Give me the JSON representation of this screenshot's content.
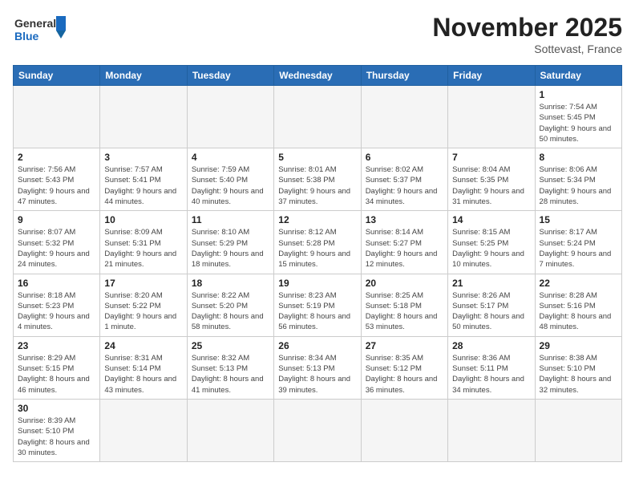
{
  "header": {
    "logo_general": "General",
    "logo_blue": "Blue",
    "month_title": "November 2025",
    "location": "Sottevast, France"
  },
  "days_of_week": [
    "Sunday",
    "Monday",
    "Tuesday",
    "Wednesday",
    "Thursday",
    "Friday",
    "Saturday"
  ],
  "weeks": [
    [
      {
        "day": "",
        "info": ""
      },
      {
        "day": "",
        "info": ""
      },
      {
        "day": "",
        "info": ""
      },
      {
        "day": "",
        "info": ""
      },
      {
        "day": "",
        "info": ""
      },
      {
        "day": "",
        "info": ""
      },
      {
        "day": "1",
        "info": "Sunrise: 7:54 AM\nSunset: 5:45 PM\nDaylight: 9 hours and 50 minutes."
      }
    ],
    [
      {
        "day": "2",
        "info": "Sunrise: 7:56 AM\nSunset: 5:43 PM\nDaylight: 9 hours and 47 minutes."
      },
      {
        "day": "3",
        "info": "Sunrise: 7:57 AM\nSunset: 5:41 PM\nDaylight: 9 hours and 44 minutes."
      },
      {
        "day": "4",
        "info": "Sunrise: 7:59 AM\nSunset: 5:40 PM\nDaylight: 9 hours and 40 minutes."
      },
      {
        "day": "5",
        "info": "Sunrise: 8:01 AM\nSunset: 5:38 PM\nDaylight: 9 hours and 37 minutes."
      },
      {
        "day": "6",
        "info": "Sunrise: 8:02 AM\nSunset: 5:37 PM\nDaylight: 9 hours and 34 minutes."
      },
      {
        "day": "7",
        "info": "Sunrise: 8:04 AM\nSunset: 5:35 PM\nDaylight: 9 hours and 31 minutes."
      },
      {
        "day": "8",
        "info": "Sunrise: 8:06 AM\nSunset: 5:34 PM\nDaylight: 9 hours and 28 minutes."
      }
    ],
    [
      {
        "day": "9",
        "info": "Sunrise: 8:07 AM\nSunset: 5:32 PM\nDaylight: 9 hours and 24 minutes."
      },
      {
        "day": "10",
        "info": "Sunrise: 8:09 AM\nSunset: 5:31 PM\nDaylight: 9 hours and 21 minutes."
      },
      {
        "day": "11",
        "info": "Sunrise: 8:10 AM\nSunset: 5:29 PM\nDaylight: 9 hours and 18 minutes."
      },
      {
        "day": "12",
        "info": "Sunrise: 8:12 AM\nSunset: 5:28 PM\nDaylight: 9 hours and 15 minutes."
      },
      {
        "day": "13",
        "info": "Sunrise: 8:14 AM\nSunset: 5:27 PM\nDaylight: 9 hours and 12 minutes."
      },
      {
        "day": "14",
        "info": "Sunrise: 8:15 AM\nSunset: 5:25 PM\nDaylight: 9 hours and 10 minutes."
      },
      {
        "day": "15",
        "info": "Sunrise: 8:17 AM\nSunset: 5:24 PM\nDaylight: 9 hours and 7 minutes."
      }
    ],
    [
      {
        "day": "16",
        "info": "Sunrise: 8:18 AM\nSunset: 5:23 PM\nDaylight: 9 hours and 4 minutes."
      },
      {
        "day": "17",
        "info": "Sunrise: 8:20 AM\nSunset: 5:22 PM\nDaylight: 9 hours and 1 minute."
      },
      {
        "day": "18",
        "info": "Sunrise: 8:22 AM\nSunset: 5:20 PM\nDaylight: 8 hours and 58 minutes."
      },
      {
        "day": "19",
        "info": "Sunrise: 8:23 AM\nSunset: 5:19 PM\nDaylight: 8 hours and 56 minutes."
      },
      {
        "day": "20",
        "info": "Sunrise: 8:25 AM\nSunset: 5:18 PM\nDaylight: 8 hours and 53 minutes."
      },
      {
        "day": "21",
        "info": "Sunrise: 8:26 AM\nSunset: 5:17 PM\nDaylight: 8 hours and 50 minutes."
      },
      {
        "day": "22",
        "info": "Sunrise: 8:28 AM\nSunset: 5:16 PM\nDaylight: 8 hours and 48 minutes."
      }
    ],
    [
      {
        "day": "23",
        "info": "Sunrise: 8:29 AM\nSunset: 5:15 PM\nDaylight: 8 hours and 46 minutes."
      },
      {
        "day": "24",
        "info": "Sunrise: 8:31 AM\nSunset: 5:14 PM\nDaylight: 8 hours and 43 minutes."
      },
      {
        "day": "25",
        "info": "Sunrise: 8:32 AM\nSunset: 5:13 PM\nDaylight: 8 hours and 41 minutes."
      },
      {
        "day": "26",
        "info": "Sunrise: 8:34 AM\nSunset: 5:13 PM\nDaylight: 8 hours and 39 minutes."
      },
      {
        "day": "27",
        "info": "Sunrise: 8:35 AM\nSunset: 5:12 PM\nDaylight: 8 hours and 36 minutes."
      },
      {
        "day": "28",
        "info": "Sunrise: 8:36 AM\nSunset: 5:11 PM\nDaylight: 8 hours and 34 minutes."
      },
      {
        "day": "29",
        "info": "Sunrise: 8:38 AM\nSunset: 5:10 PM\nDaylight: 8 hours and 32 minutes."
      }
    ],
    [
      {
        "day": "30",
        "info": "Sunrise: 8:39 AM\nSunset: 5:10 PM\nDaylight: 8 hours and 30 minutes."
      },
      {
        "day": "",
        "info": ""
      },
      {
        "day": "",
        "info": ""
      },
      {
        "day": "",
        "info": ""
      },
      {
        "day": "",
        "info": ""
      },
      {
        "day": "",
        "info": ""
      },
      {
        "day": "",
        "info": ""
      }
    ]
  ]
}
